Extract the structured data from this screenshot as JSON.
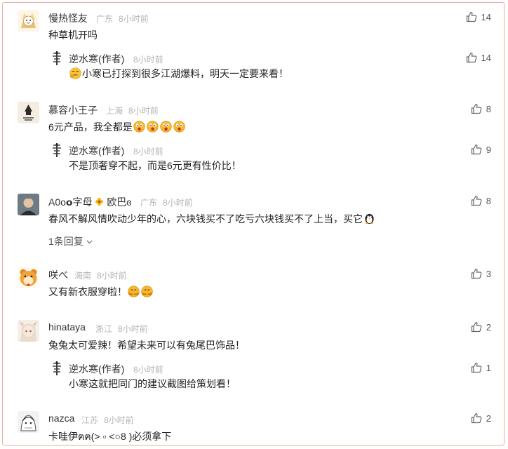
{
  "comments": [
    {
      "username": "慢热怪友",
      "location": "广东",
      "time": "8小时前",
      "text": "种草机开吗",
      "likes": "14",
      "reply": {
        "username": "逆水寒(作者)",
        "time": "8小时前",
        "text": "小寒已打探到很多江湖爆料，明天一定要来看！",
        "likes": "14"
      }
    },
    {
      "username": "慕容小王子",
      "location": "上海",
      "time": "8小时前",
      "text": "6元产品，我全都是",
      "likes": "8",
      "reply": {
        "username": "逆水寒(作者)",
        "time": "8小时前",
        "text": "不是顶奢穿不起，而是6元更有性价比！",
        "likes": "9"
      }
    },
    {
      "username": "A0o𝗼字母",
      "username_suffix": "欧巴ɞ",
      "location": "广东",
      "time": "8小时前",
      "text": "春风不解风情吹动少年的心，六块钱买不了吃亏六块钱买不了上当，买它",
      "likes": "8",
      "more_replies": "1条回复"
    },
    {
      "username": "咲べ",
      "location": "海南",
      "time": "8小时前",
      "text": "又有新衣服穿啦！",
      "likes": "3"
    },
    {
      "username": "hinataya",
      "location": "浙江",
      "time": "8小时前",
      "text": "兔兔太可爱辣！希望未来可以有兔尾巴饰品！",
      "likes": "2",
      "reply": {
        "username": "逆水寒(作者)",
        "time": "8小时前",
        "text": "小寒这就把同门的建议截图给策划看！",
        "likes": "1"
      }
    },
    {
      "username": "nazca",
      "location": "江苏",
      "time": "8小时前",
      "text": "卡哇伊ฅฅ(> ▫ <○8 )必须拿下",
      "likes": "2"
    }
  ],
  "colors": {
    "border": "#f1a9a3",
    "meta": "#b4b4b4",
    "text": "#222222"
  }
}
